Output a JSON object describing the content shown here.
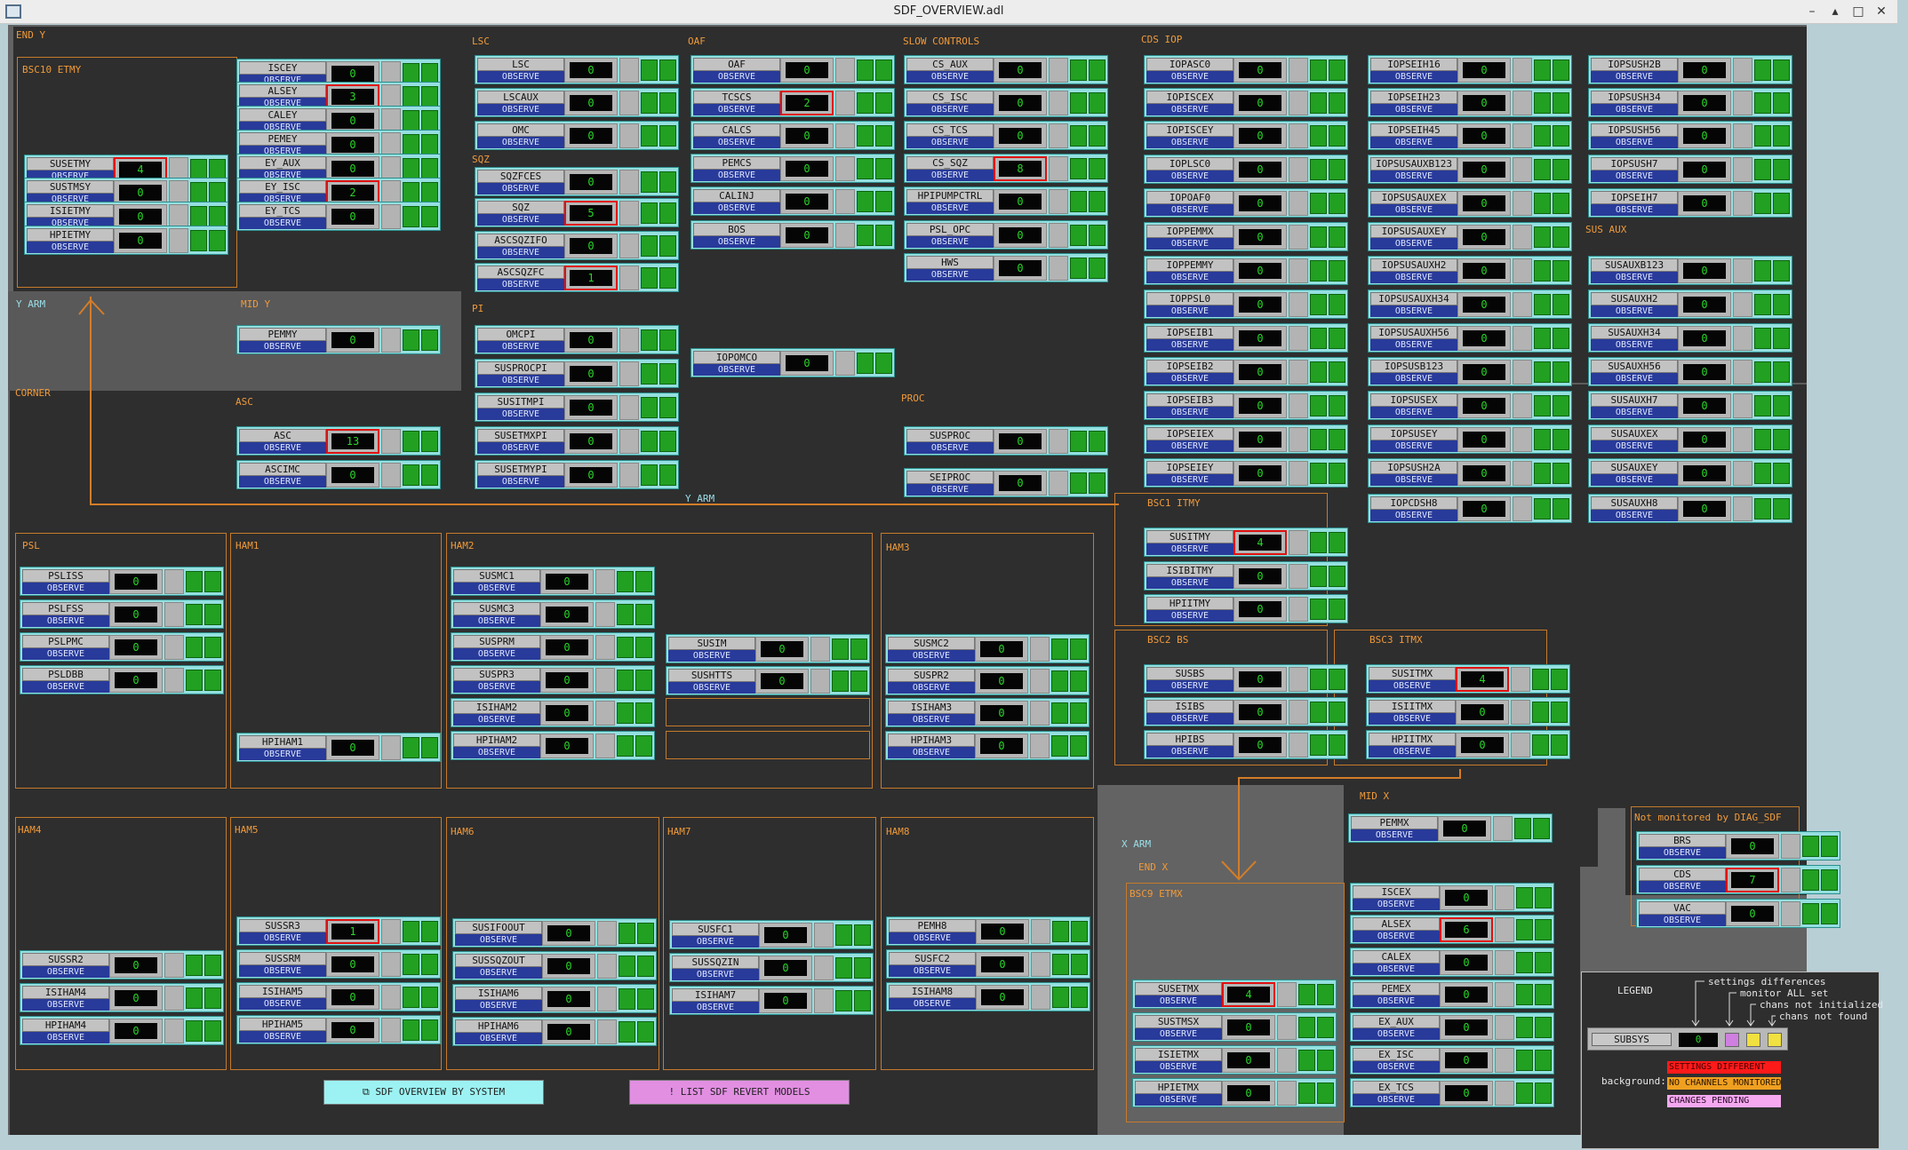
{
  "window": {
    "title": "SDF_OVERVIEW.adl",
    "minimize": "–",
    "restore": "▴",
    "maximize": "□",
    "close": "✕"
  },
  "labels": {
    "end_y": "END Y",
    "bsc10_etmy": "BSC10 ETMY",
    "y_arm_left": "Y ARM",
    "mid_y": "MID Y",
    "corner": "CORNER",
    "asc": "ASC",
    "lsc": "LSC",
    "sqz": "SQZ",
    "pi": "PI",
    "oaf": "OAF",
    "slow_controls": "SLOW CONTROLS",
    "proc": "PROC",
    "cds_iop": "CDS IOP",
    "sus_aux": "SUS AUX",
    "y_arm_mid": "Y ARM",
    "bsc1_itmy": "BSC1 ITMY",
    "bsc2_bs": "BSC2 BS",
    "bsc3_itmx": "BSC3 ITMX",
    "psl": "PSL",
    "ham1": "HAM1",
    "ham2": "HAM2",
    "ham3": "HAM3",
    "ham4": "HAM4",
    "ham5": "HAM5",
    "ham6": "HAM6",
    "ham7": "HAM7",
    "ham8": "HAM8",
    "mid_x": "MID X",
    "x_arm": "X ARM",
    "end_x": "END X",
    "bsc9_etmx": "BSC9 ETMX",
    "not_monitored": "Not monitored by DIAG_SDF"
  },
  "observe_label": "OBSERVE",
  "widgets": [
    {
      "name": "SUSETMY",
      "value": "4",
      "err": true
    },
    {
      "name": "SUSTMSY",
      "value": "0"
    },
    {
      "name": "ISIETMY",
      "value": "0"
    },
    {
      "name": "HPIETMY",
      "value": "0"
    },
    {
      "name": "ISCEY",
      "value": "0"
    },
    {
      "name": "ALSEY",
      "value": "3",
      "err": true
    },
    {
      "name": "CALEY",
      "value": "0"
    },
    {
      "name": "PEMEY",
      "value": "0"
    },
    {
      "name": "EY_AUX",
      "value": "0"
    },
    {
      "name": "EY_ISC",
      "value": "2",
      "err": true
    },
    {
      "name": "EY_TCS",
      "value": "0"
    },
    {
      "name": "PEMMY",
      "value": "0"
    },
    {
      "name": "ASC",
      "value": "13",
      "err": true
    },
    {
      "name": "ASCIMC",
      "value": "0"
    },
    {
      "name": "LSC",
      "value": "0"
    },
    {
      "name": "LSCAUX",
      "value": "0"
    },
    {
      "name": "OMC",
      "value": "0"
    },
    {
      "name": "SQZFCES",
      "value": "0"
    },
    {
      "name": "SQZ",
      "value": "5",
      "err": true
    },
    {
      "name": "ASCSQZIFO",
      "value": "0"
    },
    {
      "name": "ASCSQZFC",
      "value": "1",
      "err": true
    },
    {
      "name": "OMCPI",
      "value": "0"
    },
    {
      "name": "SUSPROCPI",
      "value": "0"
    },
    {
      "name": "SUSITMPI",
      "value": "0"
    },
    {
      "name": "SUSETMXPI",
      "value": "0"
    },
    {
      "name": "SUSETMYPI",
      "value": "0"
    },
    {
      "name": "OAF",
      "value": "0"
    },
    {
      "name": "TCSCS",
      "value": "2",
      "err": true
    },
    {
      "name": "CALCS",
      "value": "0"
    },
    {
      "name": "PEMCS",
      "value": "0"
    },
    {
      "name": "CALINJ",
      "value": "0"
    },
    {
      "name": "BOS",
      "value": "0"
    },
    {
      "name": "IOPOMCO",
      "value": "0"
    },
    {
      "name": "CS_AUX",
      "value": "0"
    },
    {
      "name": "CS_ISC",
      "value": "0"
    },
    {
      "name": "CS_TCS",
      "value": "0"
    },
    {
      "name": "CS_SQZ",
      "value": "8",
      "err": true
    },
    {
      "name": "HPIPUMPCTRL",
      "value": "0"
    },
    {
      "name": "PSL_OPC",
      "value": "0"
    },
    {
      "name": "HWS",
      "value": "0"
    },
    {
      "name": "SUSPROC",
      "value": "0"
    },
    {
      "name": "SEIPROC",
      "value": "0"
    },
    {
      "name": "IOPASC0",
      "value": "0"
    },
    {
      "name": "IOPISCEX",
      "value": "0"
    },
    {
      "name": "IOPISCEY",
      "value": "0"
    },
    {
      "name": "IOPLSC0",
      "value": "0"
    },
    {
      "name": "IOPOAF0",
      "value": "0"
    },
    {
      "name": "IOPPEMMX",
      "value": "0"
    },
    {
      "name": "IOPPEMMY",
      "value": "0"
    },
    {
      "name": "IOPPSL0",
      "value": "0"
    },
    {
      "name": "IOPSEIB1",
      "value": "0"
    },
    {
      "name": "IOPSEIB2",
      "value": "0"
    },
    {
      "name": "IOPSEIB3",
      "value": "0"
    },
    {
      "name": "IOPSEIEX",
      "value": "0"
    },
    {
      "name": "IOPSEIEY",
      "value": "0"
    },
    {
      "name": "IOPSEIH16",
      "value": "0"
    },
    {
      "name": "IOPSEIH23",
      "value": "0"
    },
    {
      "name": "IOPSEIH45",
      "value": "0"
    },
    {
      "name": "IOPSUSAUXB123",
      "value": "0"
    },
    {
      "name": "IOPSUSAUXEX",
      "value": "0"
    },
    {
      "name": "IOPSUSAUXEY",
      "value": "0"
    },
    {
      "name": "IOPSUSAUXH2",
      "value": "0"
    },
    {
      "name": "IOPSUSAUXH34",
      "value": "0"
    },
    {
      "name": "IOPSUSAUXH56",
      "value": "0"
    },
    {
      "name": "IOPSUSB123",
      "value": "0"
    },
    {
      "name": "IOPSUSEX",
      "value": "0"
    },
    {
      "name": "IOPSUSEY",
      "value": "0"
    },
    {
      "name": "IOPSUSH2A",
      "value": "0"
    },
    {
      "name": "IOPCDSH8",
      "value": "0"
    },
    {
      "name": "IOPSUSH2B",
      "value": "0"
    },
    {
      "name": "IOPSUSH34",
      "value": "0"
    },
    {
      "name": "IOPSUSH56",
      "value": "0"
    },
    {
      "name": "IOPSUSH7",
      "value": "0"
    },
    {
      "name": "IOPSEIH7",
      "value": "0"
    },
    {
      "name": "SUSAUXB123",
      "value": "0"
    },
    {
      "name": "SUSAUXH2",
      "value": "0"
    },
    {
      "name": "SUSAUXH34",
      "value": "0"
    },
    {
      "name": "SUSAUXH56",
      "value": "0"
    },
    {
      "name": "SUSAUXH7",
      "value": "0"
    },
    {
      "name": "SUSAUXEX",
      "value": "0"
    },
    {
      "name": "SUSAUXEY",
      "value": "0"
    },
    {
      "name": "SUSAUXH8",
      "value": "0"
    },
    {
      "name": "SUSITMY",
      "value": "4",
      "err": true
    },
    {
      "name": "ISIBITMY",
      "value": "0"
    },
    {
      "name": "HPIITMY",
      "value": "0"
    },
    {
      "name": "SUSBS",
      "value": "0"
    },
    {
      "name": "ISIBS",
      "value": "0"
    },
    {
      "name": "HPIBS",
      "value": "0"
    },
    {
      "name": "SUSITMX",
      "value": "4",
      "err": true
    },
    {
      "name": "ISIITMX",
      "value": "0"
    },
    {
      "name": "HPIITMX",
      "value": "0"
    },
    {
      "name": "PSLISS",
      "value": "0"
    },
    {
      "name": "PSLFSS",
      "value": "0"
    },
    {
      "name": "PSLPMC",
      "value": "0"
    },
    {
      "name": "PSLDBB",
      "value": "0"
    },
    {
      "name": "HPIHAM1",
      "value": "0"
    },
    {
      "name": "SUSMC1",
      "value": "0"
    },
    {
      "name": "SUSMC3",
      "value": "0"
    },
    {
      "name": "SUSPRM",
      "value": "0"
    },
    {
      "name": "SUSPR3",
      "value": "0"
    },
    {
      "name": "ISIHAM2",
      "value": "0"
    },
    {
      "name": "HPIHAM2",
      "value": "0"
    },
    {
      "name": "SUSIM",
      "value": "0"
    },
    {
      "name": "SUSHTTS",
      "value": "0"
    },
    {
      "name": "SUSMC2",
      "value": "0"
    },
    {
      "name": "SUSPR2",
      "value": "0"
    },
    {
      "name": "ISIHAM3",
      "value": "0"
    },
    {
      "name": "HPIHAM3",
      "value": "0"
    },
    {
      "name": "SUSSR2",
      "value": "0"
    },
    {
      "name": "ISIHAM4",
      "value": "0"
    },
    {
      "name": "HPIHAM4",
      "value": "0"
    },
    {
      "name": "SUSSR3",
      "value": "1",
      "err": true
    },
    {
      "name": "SUSSRM",
      "value": "0"
    },
    {
      "name": "ISIHAM5",
      "value": "0"
    },
    {
      "name": "HPIHAM5",
      "value": "0"
    },
    {
      "name": "SUSIFOOUT",
      "value": "0"
    },
    {
      "name": "SUSSQZOUT",
      "value": "0"
    },
    {
      "name": "ISIHAM6",
      "value": "0"
    },
    {
      "name": "HPIHAM6",
      "value": "0"
    },
    {
      "name": "SUSFC1",
      "value": "0"
    },
    {
      "name": "SUSSQZIN",
      "value": "0"
    },
    {
      "name": "ISIHAM7",
      "value": "0"
    },
    {
      "name": "PEMH8",
      "value": "0"
    },
    {
      "name": "SUSFC2",
      "value": "0"
    },
    {
      "name": "ISIHAM8",
      "value": "0"
    },
    {
      "name": "PEMMX",
      "value": "0"
    },
    {
      "name": "SUSETMX",
      "value": "4",
      "err": true
    },
    {
      "name": "SUSTMSX",
      "value": "0"
    },
    {
      "name": "ISIETMX",
      "value": "0"
    },
    {
      "name": "HPIETMX",
      "value": "0"
    },
    {
      "name": "ISCEX",
      "value": "0"
    },
    {
      "name": "ALSEX",
      "value": "6",
      "err": true
    },
    {
      "name": "CALEX",
      "value": "0"
    },
    {
      "name": "PEMEX",
      "value": "0"
    },
    {
      "name": "EX_AUX",
      "value": "0"
    },
    {
      "name": "EX_ISC",
      "value": "0"
    },
    {
      "name": "EX_TCS",
      "value": "0"
    },
    {
      "name": "BRS",
      "value": "0"
    },
    {
      "name": "CDS",
      "value": "7",
      "err": true
    },
    {
      "name": "VAC",
      "value": "0"
    }
  ],
  "buttons": {
    "sdf_by_system": "SDF OVERVIEW BY SYSTEM",
    "list_revert": "LIST SDF REVERT MODELS"
  },
  "legend": {
    "title": "LEGEND",
    "note1": "settings differences",
    "note2": "monitor ALL set",
    "note3": "chans not initialized",
    "note4": "chans not found",
    "sample_name": "SUBSYS",
    "sample_value": "0",
    "background_label": "background:",
    "settings_different": "SETTINGS DIFFERENT",
    "no_channels": "NO CHANNELS MONITORED",
    "changes_pending": "CHANGES PENDING",
    "colors": {
      "settings_different": "#ff1a1a",
      "no_channels": "#f0a020",
      "changes_pending": "#f5a8f0"
    }
  },
  "colors": {
    "ok_led": "#22a022",
    "value_text": "#2ad62a",
    "error_border": "#e01010",
    "frame": "#c67a2a",
    "widget_bg": "#94e0e0",
    "observe_bg": "#283a9a",
    "btn_cyan": "#9cf2f2",
    "btn_magenta": "#e28fe2"
  }
}
